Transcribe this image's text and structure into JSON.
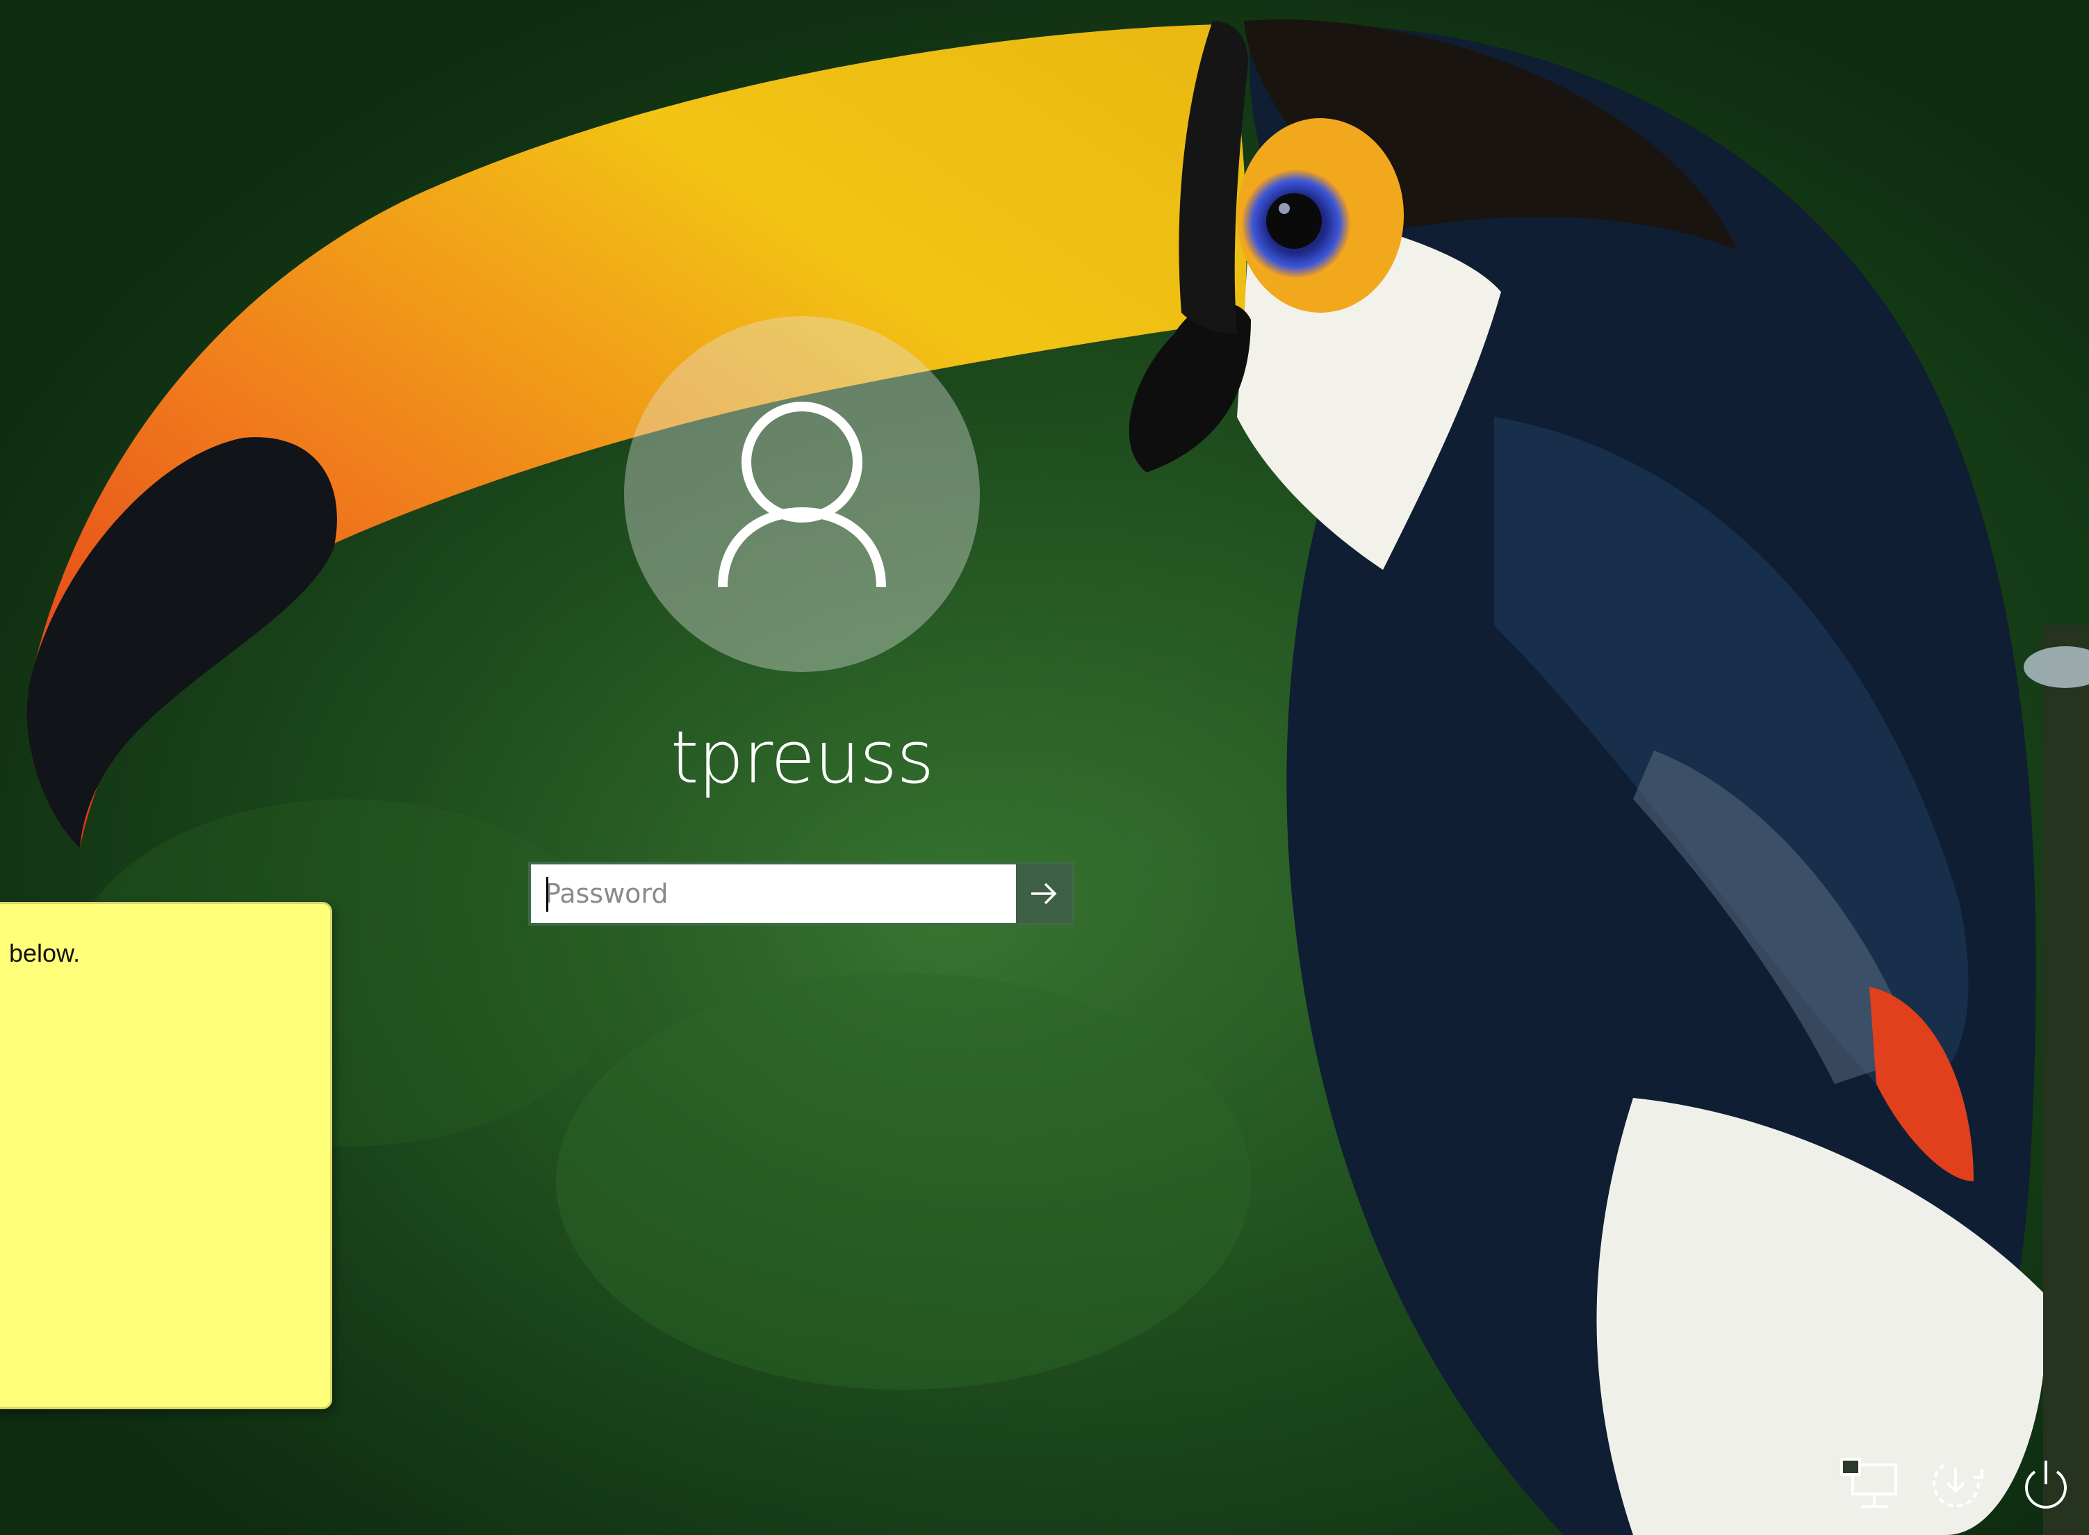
{
  "lock_screen": {
    "username": "tpreuss",
    "password_placeholder": "Password",
    "password_value": ""
  },
  "sticky_note": {
    "text": "below."
  },
  "tray": {
    "icons": [
      "network-icon",
      "ease-of-access-icon",
      "power-icon"
    ]
  },
  "colors": {
    "background": "#1b4a1c",
    "sticky_note": "#ffff7a",
    "submit_button": "#3d5f44",
    "text": "#ffffff"
  }
}
